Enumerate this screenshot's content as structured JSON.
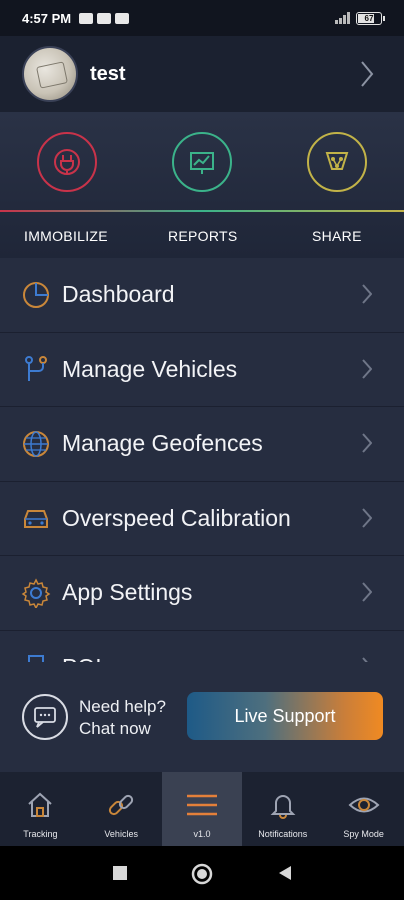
{
  "status_bar": {
    "time": "4:57 PM",
    "battery": "67"
  },
  "profile": {
    "name": "test"
  },
  "quick_actions": [
    {
      "label": "IMMOBILIZE",
      "icon": "immobilize-icon",
      "color": "#c9334a"
    },
    {
      "label": "REPORTS",
      "icon": "reports-icon",
      "color": "#3bb38a"
    },
    {
      "label": "SHARE",
      "icon": "share-icon",
      "color": "#c2b348"
    }
  ],
  "menu": [
    {
      "label": "Dashboard",
      "icon": "dashboard-icon"
    },
    {
      "label": "Manage Vehicles",
      "icon": "manage-vehicles-icon"
    },
    {
      "label": "Manage Geofences",
      "icon": "globe-icon"
    },
    {
      "label": "Overspeed Calibration",
      "icon": "car-icon"
    },
    {
      "label": "App Settings",
      "icon": "gear-icon"
    },
    {
      "label": "POI",
      "icon": "poi-icon"
    }
  ],
  "help": {
    "line1": "Need help?",
    "line2": "Chat now",
    "button": "Live Support"
  },
  "bottom_nav": [
    {
      "label": "Tracking",
      "icon": "home-icon"
    },
    {
      "label": "Vehicles",
      "icon": "link-icon"
    },
    {
      "label": "v1.0",
      "icon": "menu-icon",
      "active": true
    },
    {
      "label": "Notifications",
      "icon": "bell-icon"
    },
    {
      "label": "Spy Mode",
      "icon": "eye-icon"
    }
  ],
  "colors": {
    "accent_orange": "#f08a22",
    "accent_blue": "#1e5a87",
    "background": "#262d40"
  }
}
